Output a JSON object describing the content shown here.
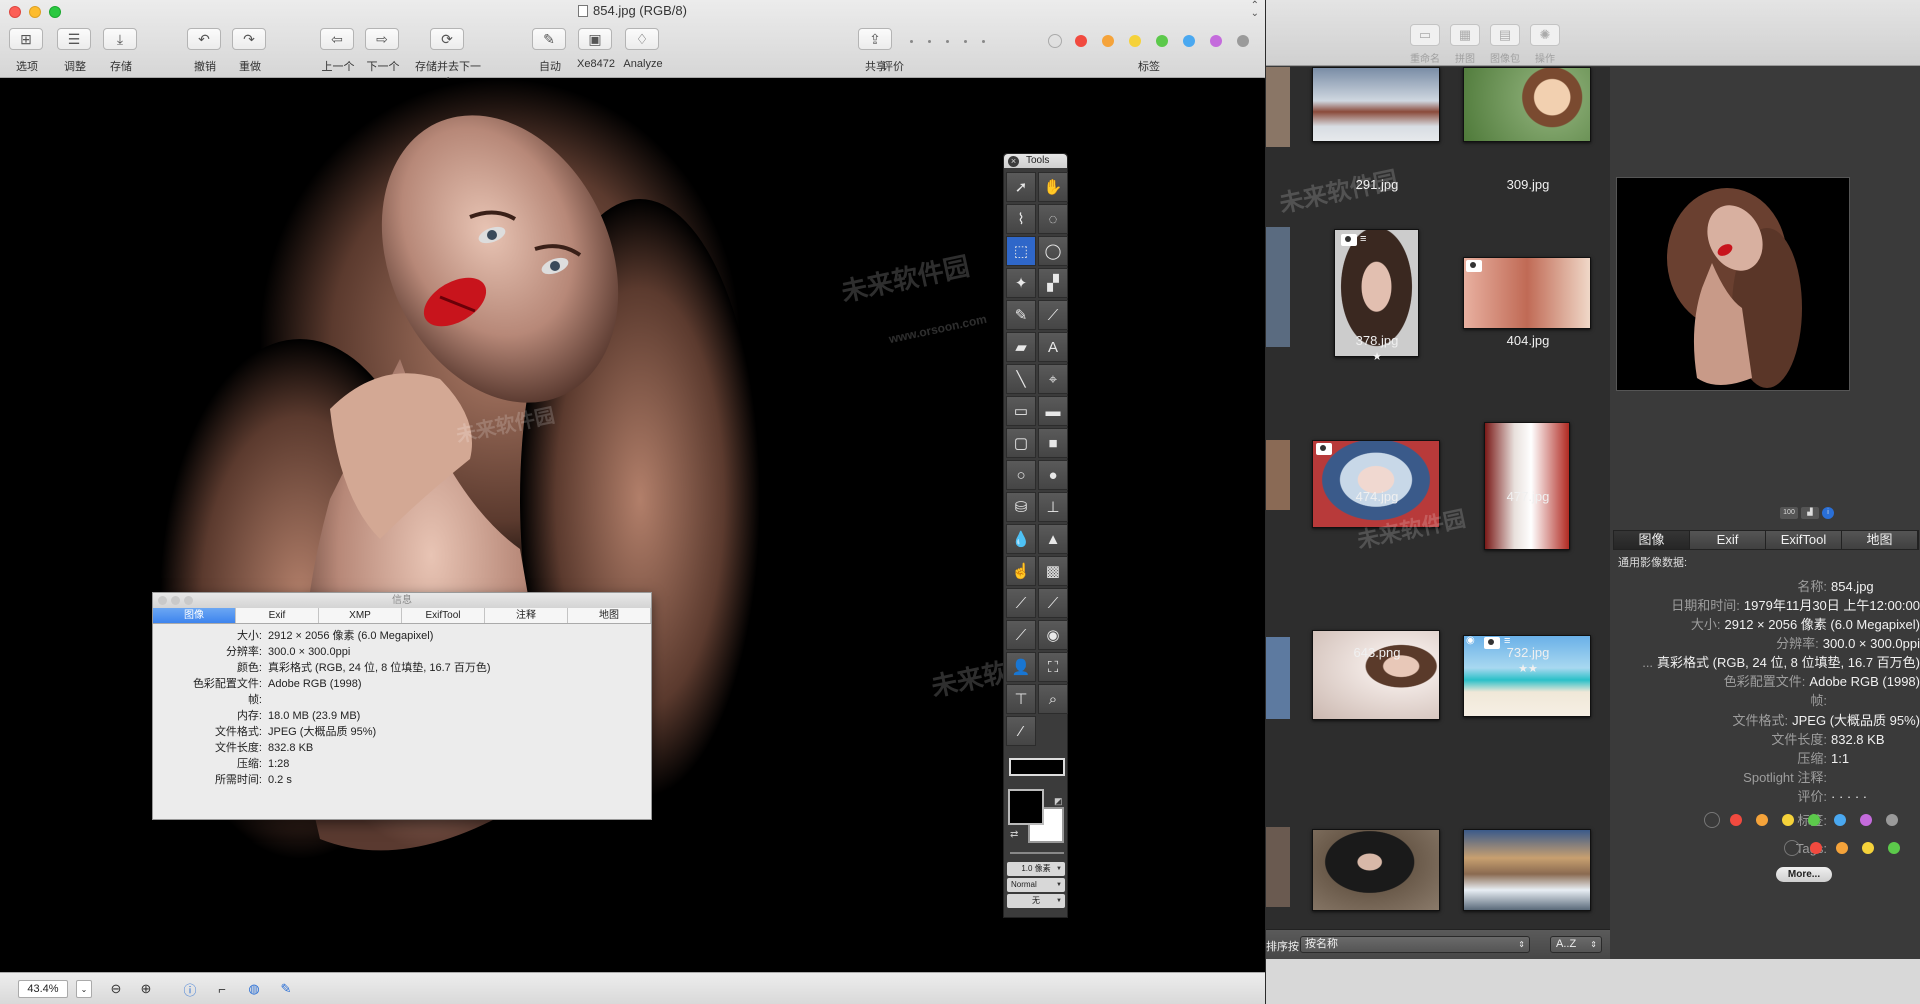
{
  "viewer": {
    "window_title": "854.jpg (RGB/8)",
    "toolbar": [
      {
        "label": "选项",
        "icon": "options-icon"
      },
      {
        "label": "调整",
        "icon": "adjust-icon"
      },
      {
        "label": "存储",
        "icon": "save-icon"
      },
      {
        "label": "撤销",
        "icon": "undo-icon"
      },
      {
        "label": "重做",
        "icon": "redo-icon"
      },
      {
        "label": "上一个",
        "icon": "arrow-left-icon"
      },
      {
        "label": "下一个",
        "icon": "arrow-right-icon"
      },
      {
        "label": "存储并去下一个",
        "icon": "save-next-icon"
      },
      {
        "label": "自动",
        "icon": "magic-wand-icon"
      },
      {
        "label": "Xe8472",
        "icon": "image-icon"
      },
      {
        "label": "Analyze",
        "icon": "lightbulb-icon"
      },
      {
        "label": "共享",
        "icon": "share-icon"
      }
    ],
    "rating_label": "评价",
    "tags_label": "标签",
    "tag_colors": [
      "#f14a3f",
      "#f5a33a",
      "#f5d23a",
      "#5cc94b",
      "#4aa8f0",
      "#c46bdc",
      "#9a9a9a"
    ],
    "zoom": "43.4%",
    "watermark": "未来软件园",
    "watermark_url": "www.orsoon.com"
  },
  "info_panel": {
    "title": "信息",
    "tabs": [
      "图像",
      "Exif",
      "XMP",
      "ExifTool",
      "注释",
      "地图"
    ],
    "rows": [
      {
        "k": "大小:",
        "v": "2912 × 2056 像素 (6.0 Megapixel)"
      },
      {
        "k": "分辨率:",
        "v": "300.0 × 300.0ppi"
      },
      {
        "k": "颜色:",
        "v": "真彩格式 (RGB, 24 位, 8 位填垫, 16.7 百万色)"
      },
      {
        "k": "色彩配置文件:",
        "v": "Adobe RGB (1998)"
      },
      {
        "k": "帧:",
        "v": ""
      },
      {
        "k": "内存:",
        "v": "18.0 MB (23.9 MB)"
      },
      {
        "k": "文件格式:",
        "v": "JPEG (大概品质 95%)"
      },
      {
        "k": "文件长度:",
        "v": "832.8 KB"
      },
      {
        "k": "压缩:",
        "v": "1:28"
      },
      {
        "k": "所需时间:",
        "v": "0.2 s"
      }
    ]
  },
  "tools": {
    "title": "Tools",
    "items": [
      {
        "name": "arrow-pointer-icon",
        "glyph": "➚"
      },
      {
        "name": "hand-icon",
        "glyph": "✋"
      },
      {
        "name": "polygon-lasso-icon",
        "glyph": "⌇"
      },
      {
        "name": "lasso-icon",
        "glyph": "◌"
      },
      {
        "name": "rect-select-icon",
        "glyph": "⬚"
      },
      {
        "name": "ellipse-select-icon",
        "glyph": "◯"
      },
      {
        "name": "magic-wand-icon",
        "glyph": "✦"
      },
      {
        "name": "clone-icon",
        "glyph": "▞"
      },
      {
        "name": "pencil-icon",
        "glyph": "✎"
      },
      {
        "name": "brush-icon",
        "glyph": "⟋"
      },
      {
        "name": "eraser-icon",
        "glyph": "▰"
      },
      {
        "name": "text-icon",
        "glyph": "A"
      },
      {
        "name": "line-icon",
        "glyph": "╲"
      },
      {
        "name": "crosshair-icon",
        "glyph": "⌖"
      },
      {
        "name": "rect-outline-icon",
        "glyph": "▭"
      },
      {
        "name": "rect-fill-icon",
        "glyph": "▬"
      },
      {
        "name": "round-rect-icon",
        "glyph": "▢"
      },
      {
        "name": "round-rect-fill-icon",
        "glyph": "■"
      },
      {
        "name": "circle-outline-icon",
        "glyph": "○"
      },
      {
        "name": "circle-fill-icon",
        "glyph": "●"
      },
      {
        "name": "bucket-icon",
        "glyph": "⛁"
      },
      {
        "name": "stamp-icon",
        "glyph": "⊥"
      },
      {
        "name": "drop-icon",
        "glyph": "💧"
      },
      {
        "name": "sharpen-icon",
        "glyph": "▲"
      },
      {
        "name": "smudge-icon",
        "glyph": "☝"
      },
      {
        "name": "sponge-icon",
        "glyph": "▩"
      },
      {
        "name": "dodge-icon",
        "glyph": "⟋"
      },
      {
        "name": "burn-icon",
        "glyph": "⟋"
      },
      {
        "name": "heal-icon",
        "glyph": "⟋"
      },
      {
        "name": "redeye-icon",
        "glyph": "◉"
      },
      {
        "name": "person-icon",
        "glyph": "👤"
      },
      {
        "name": "frame-icon",
        "glyph": "⛶"
      },
      {
        "name": "hair-dryer-icon",
        "glyph": "⊤"
      },
      {
        "name": "zoom-icon",
        "glyph": "⌕"
      },
      {
        "name": "eyedropper-icon",
        "glyph": "⁄"
      }
    ],
    "line_width": "1.0 像素",
    "blend_mode": "Normal",
    "style": "无"
  },
  "browser": {
    "toolbar": [
      {
        "label": "重命名",
        "icon": "rename-icon"
      },
      {
        "label": "拼图",
        "icon": "collage-icon"
      },
      {
        "label": "图像包",
        "icon": "contact-sheet-icon"
      },
      {
        "label": "操作",
        "icon": "gear-icon"
      }
    ],
    "thumbnails": [
      {
        "name": "291.jpg",
        "stars": ""
      },
      {
        "name": "309.jpg",
        "stars": ""
      },
      {
        "name": "378.jpg",
        "stars": "★"
      },
      {
        "name": "404.jpg",
        "stars": ""
      },
      {
        "name": "474.jpg",
        "stars": ""
      },
      {
        "name": "477.jpg",
        "stars": ""
      },
      {
        "name": "643.png",
        "stars": ""
      },
      {
        "name": "732.jpg",
        "stars": "★★"
      }
    ],
    "sort_label": "排序按:",
    "sort_value": "按名称",
    "order_value": "A..Z",
    "side_tabs": [
      "图像",
      "Exif",
      "ExifTool",
      "地图"
    ],
    "section_title": "通用影像数据:",
    "meta": [
      {
        "k": "名称:",
        "v": "854.jpg"
      },
      {
        "k": "日期和时间:",
        "v": "1979年11月30日 上午12:00:00"
      },
      {
        "k": "大小:",
        "v": "2912 × 2056 像素 (6.0 Megapixel)"
      },
      {
        "k": "分辨率:",
        "v": "300.0 × 300.0ppi"
      },
      {
        "k": "...",
        "v": "真彩格式 (RGB, 24 位, 8 位填垫, 16.7 百万色)"
      },
      {
        "k": "色彩配置文件:",
        "v": "Adobe RGB (1998)"
      },
      {
        "k": "帧:",
        "v": ""
      },
      {
        "k": "文件格式:",
        "v": "JPEG (大概品质 95%)"
      },
      {
        "k": "文件长度:",
        "v": "832.8 KB"
      },
      {
        "k": "压缩:",
        "v": "1:1"
      },
      {
        "k": "Spotlight 注释:",
        "v": ""
      },
      {
        "k": "评价:",
        "v": "· · · · ·"
      },
      {
        "k": "标签:",
        "v": ""
      },
      {
        "k": "Tags:",
        "v": ""
      }
    ],
    "more_label": "More..."
  }
}
